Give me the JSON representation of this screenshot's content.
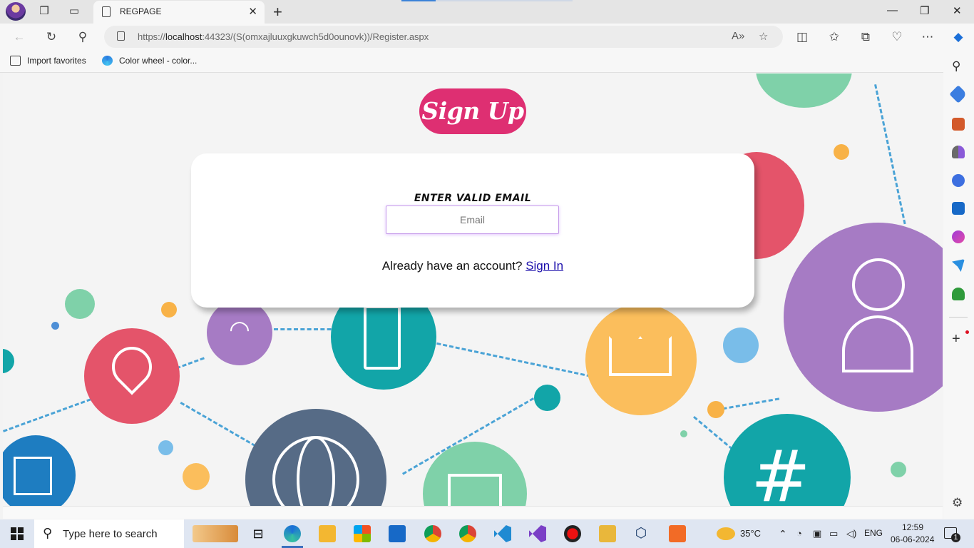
{
  "browser": {
    "tab_title": "REGPAGE",
    "url_prefix": "https://",
    "url_host": "localhost",
    "url_rest": ":44323/(S(omxajluuxgkuwch5d0ounovk))/Register.aspx",
    "favorites": [
      "Import favorites",
      "Color wheel - color..."
    ]
  },
  "page": {
    "heading": "Sign Up",
    "email_label": "ENTER VALID EMAIL",
    "email_placeholder": "Email",
    "account_prompt": "Already have an account? ",
    "signin_link": "Sign In"
  },
  "taskbar": {
    "search_placeholder": "Type here to search",
    "weather": "35°C",
    "language": "ENG",
    "time": "12:59",
    "date": "06-06-2024",
    "notifications": "1"
  },
  "colors": {
    "signup_pill": "#de2f72",
    "link": "#1a0dab",
    "input_border": "#c69bea"
  }
}
